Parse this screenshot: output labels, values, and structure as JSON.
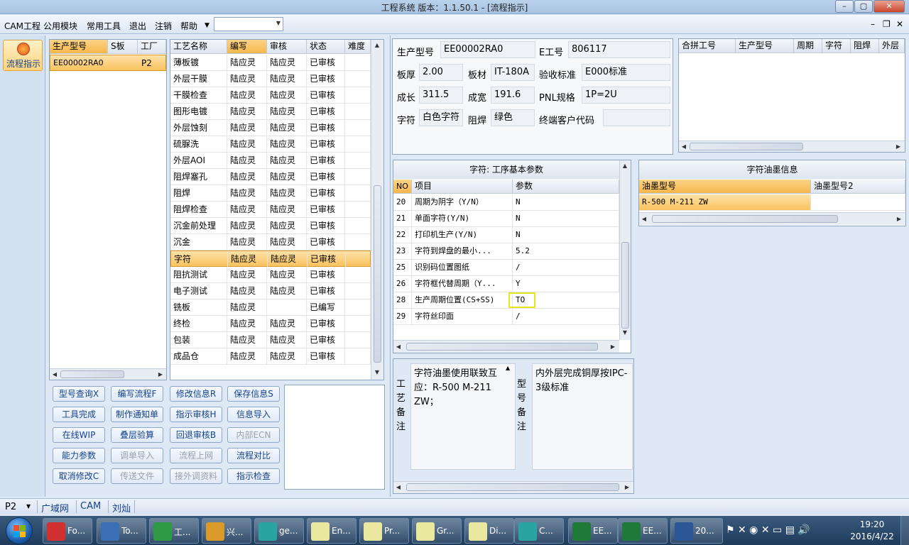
{
  "window": {
    "title": "工程系统   版本：1.1.50.1 - [流程指示]"
  },
  "menu": [
    "CAM工程",
    "公用模块",
    "常用工具",
    "退出",
    "注销",
    "帮助"
  ],
  "menu_combo_value": "",
  "side_nav": {
    "label": "流程指示"
  },
  "product_list": {
    "headers": [
      "生产型号",
      "S板",
      "工厂"
    ],
    "rows": [
      {
        "model": "EE00002RA0",
        "s": "",
        "factory": "P2"
      }
    ]
  },
  "process_table": {
    "headers": [
      "工艺名称",
      "编写",
      "审核",
      "状态",
      "难度"
    ],
    "rows": [
      [
        "薄板镀",
        "陆应灵",
        "陆应灵",
        "已审核",
        ""
      ],
      [
        "外层干膜",
        "陆应灵",
        "陆应灵",
        "已审核",
        ""
      ],
      [
        "干膜检查",
        "陆应灵",
        "陆应灵",
        "已审核",
        ""
      ],
      [
        "图形电镀",
        "陆应灵",
        "陆应灵",
        "已审核",
        ""
      ],
      [
        "外层蚀刻",
        "陆应灵",
        "陆应灵",
        "已审核",
        ""
      ],
      [
        "硫脲洗",
        "陆应灵",
        "陆应灵",
        "已审核",
        ""
      ],
      [
        "外层AOI",
        "陆应灵",
        "陆应灵",
        "已审核",
        ""
      ],
      [
        "阻焊塞孔",
        "陆应灵",
        "陆应灵",
        "已审核",
        ""
      ],
      [
        "阻焊",
        "陆应灵",
        "陆应灵",
        "已审核",
        ""
      ],
      [
        "阻焊检查",
        "陆应灵",
        "陆应灵",
        "已审核",
        ""
      ],
      [
        "沉金前处理",
        "陆应灵",
        "陆应灵",
        "已审核",
        ""
      ],
      [
        "沉金",
        "陆应灵",
        "陆应灵",
        "已审核",
        ""
      ],
      [
        "字符",
        "陆应灵",
        "陆应灵",
        "已审核",
        ""
      ],
      [
        "阻抗测试",
        "陆应灵",
        "陆应灵",
        "已审核",
        ""
      ],
      [
        "电子测试",
        "陆应灵",
        "陆应灵",
        "已审核",
        ""
      ],
      [
        "铣板",
        "陆应灵",
        "",
        "已编写",
        ""
      ],
      [
        "终检",
        "陆应灵",
        "陆应灵",
        "已审核",
        ""
      ],
      [
        "包装",
        "陆应灵",
        "陆应灵",
        "已审核",
        ""
      ],
      [
        "成品仓",
        "陆应灵",
        "陆应灵",
        "已审核",
        ""
      ]
    ],
    "selected_index": 12
  },
  "buttons": [
    [
      "型号查询X",
      "编写流程F",
      "修改信息R",
      "保存信息S"
    ],
    [
      "工具完成",
      "制作通知单",
      "指示审核H",
      "信息导入"
    ],
    [
      "在线WIP",
      "叠层验算",
      "回退审核B",
      "内部ECN"
    ],
    [
      "能力参数",
      "调单导入",
      "流程上网",
      "流程对比"
    ],
    [
      "取消修改C",
      "传送文件",
      "接外调资料",
      "指示检查"
    ]
  ],
  "info": {
    "model_label": "生产型号",
    "model": "EE00002RA0",
    "job_label": "E工号",
    "job": "806117",
    "thick_label": "板厚",
    "thick": "2.00",
    "material_label": "板材",
    "material": "IT-180A",
    "std_label": "验收标准",
    "std": "E000标准",
    "len_label": "成长",
    "len": "311.5",
    "wid_label": "成宽",
    "wid": "191.6",
    "pnl_label": "PNL规格",
    "pnl": "1P=2U",
    "char_label": "字符",
    "char": "白色字符",
    "mask_label": "阻焊",
    "mask": "绿色",
    "cust_label": "终端客户代码",
    "cust": ""
  },
  "merge_table": {
    "headers": [
      "合拼工号",
      "生产型号",
      "周期",
      "字符",
      "阻焊",
      "外层"
    ]
  },
  "param_table": {
    "title": "字符: 工序基本参数",
    "headers": [
      "NO",
      "项目",
      "参数"
    ],
    "rows": [
      [
        "20",
        "周期为阴字（Y/N）",
        "N"
      ],
      [
        "21",
        "单面字符(Y/N)",
        "N"
      ],
      [
        "22",
        "打印机生产(Y/N)",
        "N"
      ],
      [
        "23",
        "字符到焊盘的最小...",
        "5.2"
      ],
      [
        "25",
        "识别码位置图纸",
        "/"
      ],
      [
        "26",
        "字符框代替周期（Y...",
        "Y"
      ],
      [
        "28",
        "生产周期位置(CS+SS)",
        "TO"
      ],
      [
        "29",
        "字符丝印面",
        "/"
      ]
    ]
  },
  "ink_table": {
    "title": "字符油墨信息",
    "headers": [
      "油墨型号",
      "油墨型号2"
    ],
    "rows": [
      [
        "R-500 M-211 ZW",
        ""
      ]
    ]
  },
  "notes": {
    "proc_label": "工艺备注",
    "proc_text": "字符油墨使用联致互应：R-500 M-211 ZW；",
    "model_label": "型号备注",
    "model_text": "内外层完成铜厚按IPC-3级标准"
  },
  "status": {
    "factory": "P2",
    "items": [
      "广域网",
      "CAM",
      "刘灿"
    ]
  },
  "taskbar": {
    "items": [
      {
        "label": "Fo...",
        "color": "#d03030"
      },
      {
        "label": "To...",
        "color": "#3a6fb5"
      },
      {
        "label": "工...",
        "color": "#2f9a44"
      },
      {
        "label": "兴...",
        "color": "#d99a2a"
      },
      {
        "label": "ge...",
        "color": "#2aa3a3"
      },
      {
        "label": "En...",
        "color": "#e9e7a0"
      },
      {
        "label": "Pr...",
        "color": "#e9e7a0"
      },
      {
        "label": "Gr...",
        "color": "#e9e7a0"
      },
      {
        "label": "Di...",
        "color": "#e9e7a0"
      },
      {
        "label": "C...",
        "color": "#2aa3a3"
      },
      {
        "label": "EE...",
        "color": "#1f7a3a"
      },
      {
        "label": "EE...",
        "color": "#1f7a3a"
      },
      {
        "label": "20...",
        "color": "#2b5797"
      }
    ],
    "time": "19:20",
    "date": "2016/4/22"
  }
}
